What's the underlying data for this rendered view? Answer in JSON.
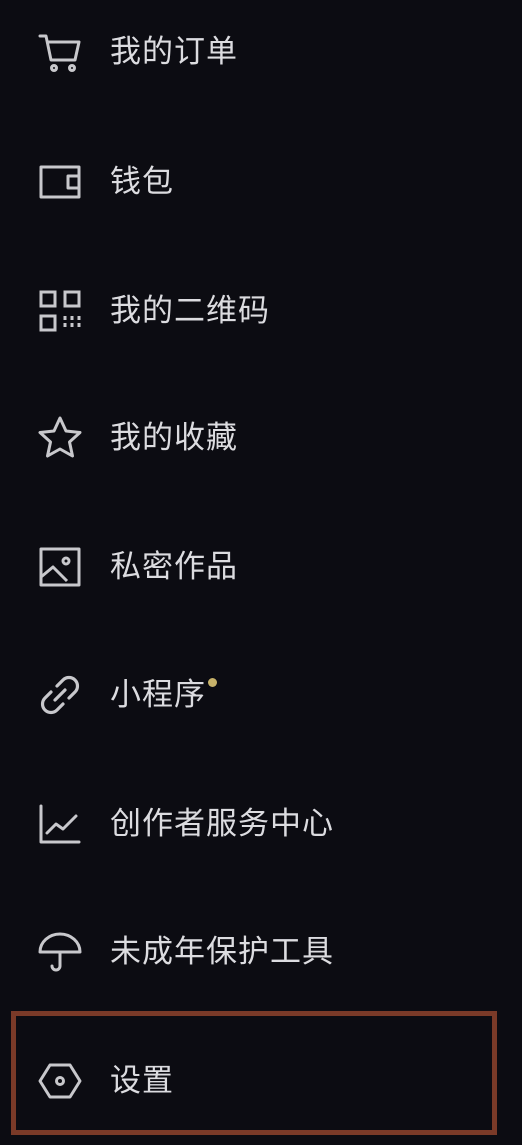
{
  "colors": {
    "background": "#0c0c12",
    "text": "#dcdce0",
    "icon_stroke": "#c8c8cc",
    "notification_dot": "#c7b26a",
    "highlight_border": "#7a3a28"
  },
  "menu": {
    "items": [
      {
        "label": "我的订单",
        "icon": "cart-icon"
      },
      {
        "label": "钱包",
        "icon": "wallet-icon"
      },
      {
        "label": "我的二维码",
        "icon": "qr-code-icon"
      },
      {
        "label": "我的收藏",
        "icon": "star-icon"
      },
      {
        "label": "私密作品",
        "icon": "image-icon"
      },
      {
        "label": "小程序",
        "icon": "link-icon",
        "has_dot": true
      },
      {
        "label": "创作者服务中心",
        "icon": "line-chart-icon"
      },
      {
        "label": "未成年保护工具",
        "icon": "umbrella-icon"
      },
      {
        "label": "设置",
        "icon": "hexagon-settings-icon",
        "highlighted": true
      }
    ]
  }
}
